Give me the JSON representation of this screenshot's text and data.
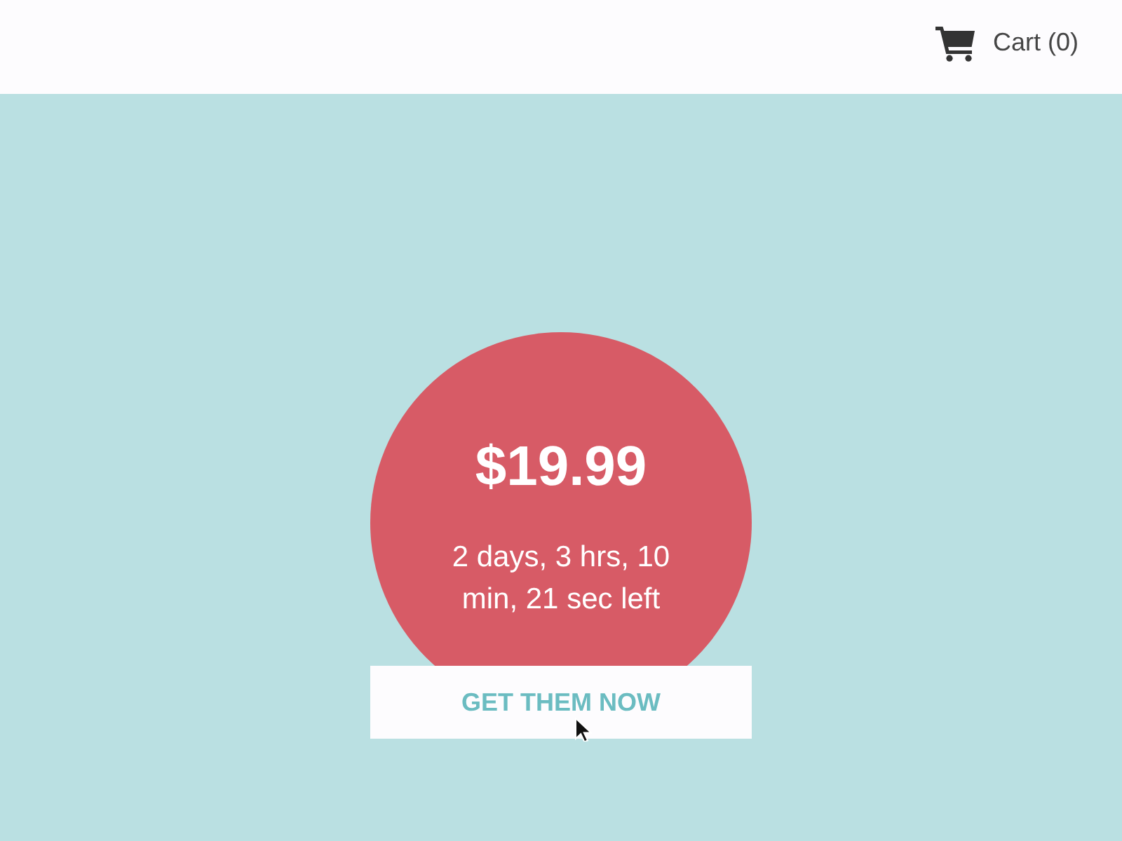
{
  "header": {
    "cart": {
      "label": "Cart (0)"
    }
  },
  "offer": {
    "price": "$19.99",
    "countdown": "2 days, 3 hrs, 10 min, 21 sec left",
    "button": "GET THEM NOW"
  }
}
